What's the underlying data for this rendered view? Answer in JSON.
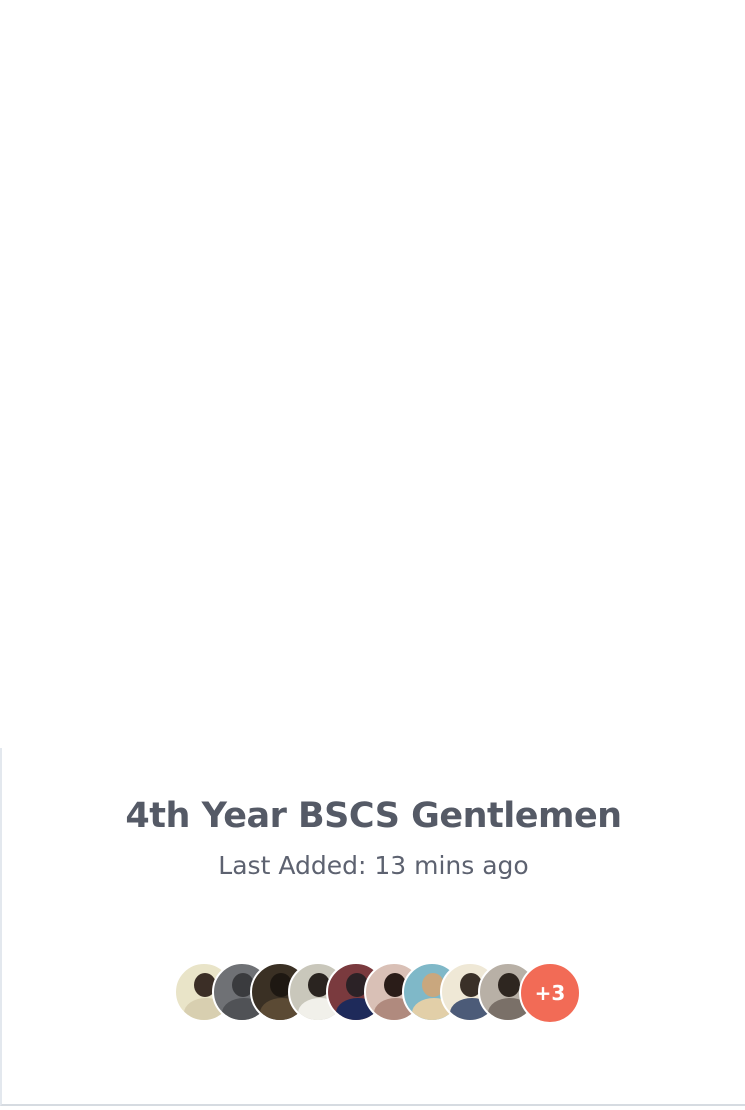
{
  "group": {
    "title": "4th Year BSCS Gentlemen",
    "last_added": "Last Added: 13 mins ago"
  },
  "members": {
    "avatars": [
      {
        "name": "member-avatar-1",
        "bg": "#e9e4c8",
        "head": "#3b2e26",
        "body": "#d8cfb0"
      },
      {
        "name": "member-avatar-2",
        "bg": "#6f7175",
        "head": "#3a3b3e",
        "body": "#505256"
      },
      {
        "name": "member-avatar-3",
        "bg": "#3a3024",
        "head": "#1e1812",
        "body": "#5b4a34"
      },
      {
        "name": "member-avatar-4",
        "bg": "#c9c7bb",
        "head": "#2a2420",
        "body": "#f1f0ea"
      },
      {
        "name": "member-avatar-5",
        "bg": "#7a3a3e",
        "head": "#2b2226",
        "body": "#1e2a5a"
      },
      {
        "name": "member-avatar-6",
        "bg": "#d9c0b6",
        "head": "#2a1c18",
        "body": "#b08a7e"
      },
      {
        "name": "member-avatar-7",
        "bg": "#7fb8c8",
        "head": "#c9a77e",
        "body": "#e2cfa8"
      },
      {
        "name": "member-avatar-8",
        "bg": "#efe8d6",
        "head": "#3a3028",
        "body": "#4c5b78"
      },
      {
        "name": "member-avatar-9",
        "bg": "#b8b0a6",
        "head": "#2e2620",
        "body": "#7a7068"
      }
    ],
    "more_count": "+3",
    "more_color": "#f26b56"
  }
}
